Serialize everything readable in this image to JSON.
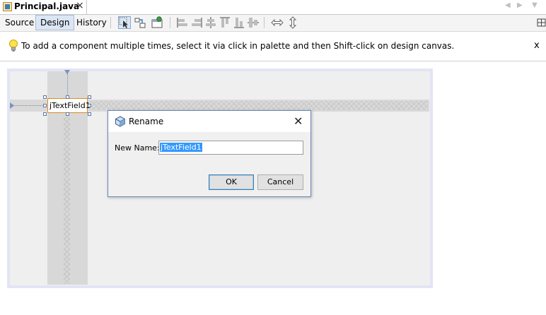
{
  "tab": {
    "title": "Principal.java",
    "close_label": "×"
  },
  "tab_nav": {
    "left": "◀",
    "right": "▶",
    "menu": "▼"
  },
  "toolbar": {
    "views": [
      "Source",
      "Design",
      "History"
    ],
    "active_view": "Design",
    "icons": [
      "selection-mode-icon",
      "connection-mode-icon",
      "preview-design-icon",
      "align-left-icon",
      "align-right-icon",
      "center-horizontal-icon",
      "align-top-icon",
      "align-bottom-icon",
      "center-vertical-icon",
      "resize-horizontal-icon",
      "resize-vertical-icon",
      "maximize-editor-icon"
    ]
  },
  "infobar": {
    "message": "To add a component multiple times, select it via click in palette and then Shift-click on design canvas.",
    "close_label": "x"
  },
  "canvas": {
    "component_text": "jTextField1"
  },
  "dialog": {
    "title": "Rename",
    "close_label": "✕",
    "field_label": "New Name:",
    "field_value": "jTextField1",
    "ok_label": "OK",
    "cancel_label": "Cancel"
  },
  "colors": {
    "selection_highlight": "#3399ff",
    "component_border": "#e08a1e",
    "dialog_border": "#6b88b8",
    "form_frame": "#e3e4f5"
  }
}
